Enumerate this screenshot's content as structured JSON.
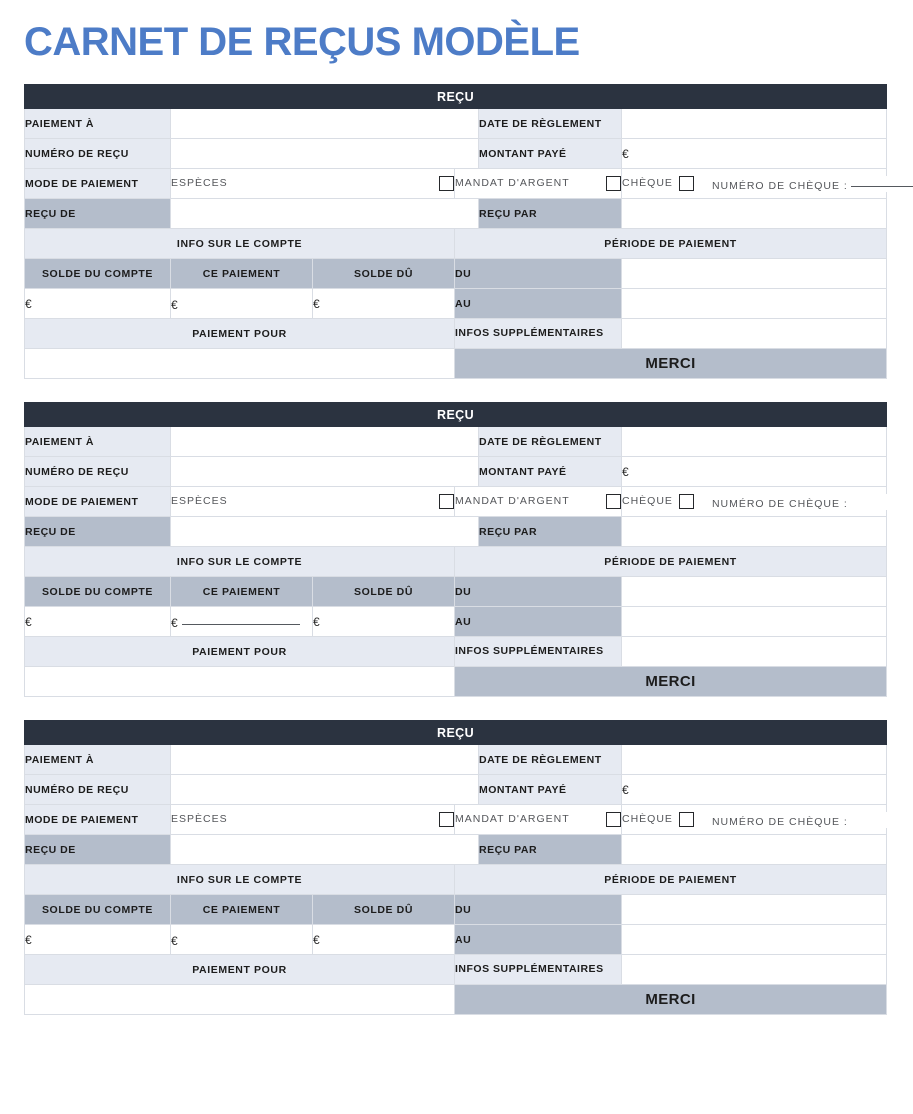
{
  "document": {
    "title": "CARNET DE REÇUS MODÈLE",
    "title_color": "#4d7cc7",
    "header_bar_color": "#2b3340",
    "label_bg_light": "#e6eaf2",
    "label_bg_dark": "#b4bdcb",
    "currency_symbol": "€"
  },
  "labels": {
    "receipt_header": "REÇU",
    "pay_to": "PAIEMENT À",
    "receipt_number": "NUMÉRO DE REÇU",
    "payment_method": "MODE DE PAIEMENT",
    "cash": "ESPÈCES",
    "money_order": "MANDAT D'ARGENT",
    "received_from": "REÇU DE",
    "settlement_date": "DATE DE RÈGLEMENT",
    "amount_paid": "MONTANT PAYÉ",
    "cheque": "CHÈQUE",
    "cheque_number": "NUMÉRO DE CHÈQUE :",
    "received_by": "REÇU PAR",
    "account_info": "INFO SUR LE COMPTE",
    "account_balance": "SOLDE DU COMPTE",
    "this_payment": "CE PAIEMENT",
    "balance_due": "SOLDE DÛ",
    "payment_for": "PAIEMENT POUR",
    "payment_period": "PÉRIODE DE PAIEMENT",
    "from": "DU",
    "to": "AU",
    "additional_info": "INFOS SUPPLÉMENTAIRES",
    "thank_you": "MERCI"
  },
  "receipts": [
    {
      "id": "receipt-1",
      "pay_to_value": "",
      "receipt_number_value": "",
      "settlement_date_value": "",
      "amount_paid_value": "",
      "received_from_value": "",
      "received_by_value": "",
      "cheque_number_value": "",
      "cheque_number_has_line": true,
      "cash_checked": false,
      "money_order_checked": false,
      "cheque_checked": false,
      "account_balance_value": "",
      "this_payment_value": "",
      "this_payment_has_line": false,
      "balance_due_value": "",
      "payment_for_value": "",
      "period_from_value": "",
      "period_to_value": "",
      "additional_info_value": ""
    },
    {
      "id": "receipt-2",
      "pay_to_value": "",
      "receipt_number_value": "",
      "settlement_date_value": "",
      "amount_paid_value": "",
      "received_from_value": "",
      "received_by_value": "",
      "cheque_number_value": "",
      "cheque_number_has_line": false,
      "cash_checked": false,
      "money_order_checked": false,
      "cheque_checked": false,
      "account_balance_value": "",
      "this_payment_value": "",
      "this_payment_has_line": true,
      "balance_due_value": "",
      "payment_for_value": "",
      "period_from_value": "",
      "period_to_value": "",
      "additional_info_value": ""
    },
    {
      "id": "receipt-3",
      "pay_to_value": "",
      "receipt_number_value": "",
      "settlement_date_value": "",
      "amount_paid_value": "",
      "received_from_value": "",
      "received_by_value": "",
      "cheque_number_value": "",
      "cheque_number_has_line": false,
      "cash_checked": false,
      "money_order_checked": false,
      "cheque_checked": false,
      "account_balance_value": "",
      "this_payment_value": "",
      "this_payment_has_line": false,
      "balance_due_value": "",
      "payment_for_value": "",
      "period_from_value": "",
      "period_to_value": "",
      "additional_info_value": ""
    }
  ]
}
